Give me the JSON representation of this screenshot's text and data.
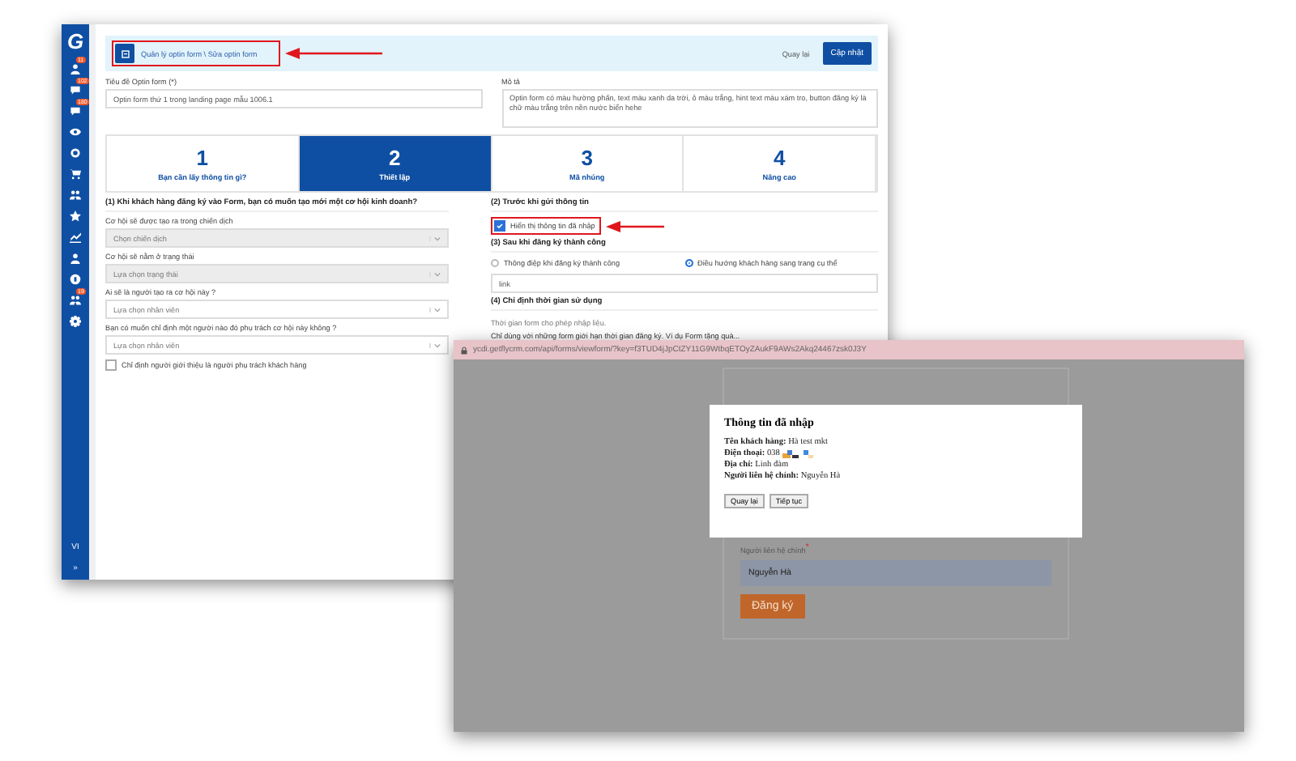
{
  "sidebar": {
    "logo": "G",
    "items": [
      {
        "kind": "person",
        "badge": "11"
      },
      {
        "kind": "message",
        "badge": "102"
      },
      {
        "kind": "message",
        "badge": "180"
      },
      {
        "kind": "eye"
      },
      {
        "kind": "target"
      },
      {
        "kind": "cart"
      },
      {
        "kind": "group"
      },
      {
        "kind": "star"
      },
      {
        "kind": "chart"
      },
      {
        "kind": "person"
      },
      {
        "kind": "coin"
      },
      {
        "kind": "group",
        "badge": "19"
      },
      {
        "kind": "gear"
      }
    ],
    "language": "VI",
    "expand": "»"
  },
  "header": {
    "breadcrumb": "Quản lý optin form \\ Sửa optin form",
    "back": "Quay lại",
    "save": "Cập nhật"
  },
  "title_field": {
    "label": "Tiêu đề Optin form (*)",
    "value": "Optin form thứ 1 trong landing page mẫu 1006.1"
  },
  "description_field": {
    "label": "Mô tả",
    "value": "Optin form có màu hường phấn, text màu xanh da trời, ô màu trắng, hint text màu xám tro, button đăng ký là chữ màu trắng trên nền nước biển hehe"
  },
  "steps": [
    {
      "number": "1",
      "label": "Bạn cần lấy thông tin gì?",
      "selected": false
    },
    {
      "number": "2",
      "label": "Thiết lập",
      "selected": true
    },
    {
      "number": "3",
      "label": "Mã nhúng",
      "selected": false
    },
    {
      "number": "4",
      "label": "Nâng cao",
      "selected": false
    }
  ],
  "opportunity": {
    "heading": "(1) Khi khách hàng đăng ký vào Form, bạn có muốn tạo mới một cơ hội kinh doanh?",
    "selects": [
      {
        "label": "Cơ hội sẽ được tạo ra trong chiến dịch",
        "placeholder": "Chọn chiến dịch",
        "disabled": true
      },
      {
        "label": "Cơ hội sẽ nằm ở trạng thái",
        "placeholder": "Lựa chọn trạng thái",
        "disabled": true
      },
      {
        "label": "Ai sẽ là người tạo ra cơ hội này ?",
        "placeholder": "Lựa chọn nhân viên",
        "disabled": false
      },
      {
        "label": "Bạn có muốn chỉ định một người nào đó phụ trách cơ hội này không ?",
        "placeholder": "Lựa chọn nhân viên",
        "disabled": false
      }
    ],
    "referrer_checkbox": {
      "label": "Chỉ định người giới thiệu là người phụ trách khách hàng",
      "checked": false
    }
  },
  "before_submit": {
    "heading": "(2) Trước khi gửi thông tin",
    "checkbox": {
      "label": "Hiển thị thông tin đã nhập",
      "checked": true
    }
  },
  "after_submit": {
    "heading": "(3) Sau khi đăng ký thành công",
    "options": [
      {
        "label": "Thông điệp khi đăng ký thành công",
        "selected": false
      },
      {
        "label": "Điều hướng khách hàng sang trang cụ thể",
        "selected": true
      }
    ],
    "link_value": "link"
  },
  "usage_time": {
    "heading": "(4) Chỉ định thời gian sử dụng",
    "lines": [
      "Thời gian form cho phép nhập liệu.",
      "Chỉ dùng với những form giới hạn thời gian đăng ký. Ví dụ Form tặng quà..."
    ]
  },
  "preview": {
    "url": "ycdi.getflycrm.com/api/forms/viewform/?key=f3TUD4jJpCtZY11G9WtbqETOyZAukF9AWs2Akq24467zsk0J3Y",
    "dialog": {
      "title": "Thông tin đã nhập",
      "lines": [
        "**Tên khách hàng:** Hà test mkt",
        "**Điện thoại:** 038",
        "**Địa chỉ:** Linh đàm",
        "**Người liên hệ chính:** Nguyễn Hà"
      ],
      "buttons": [
        "Quay lại",
        "Tiếp tục"
      ]
    },
    "contact_label": "Người liên hệ chính",
    "required_mark": "*",
    "contact_value": "Nguyễn Hà",
    "submit": "Đăng ký"
  }
}
